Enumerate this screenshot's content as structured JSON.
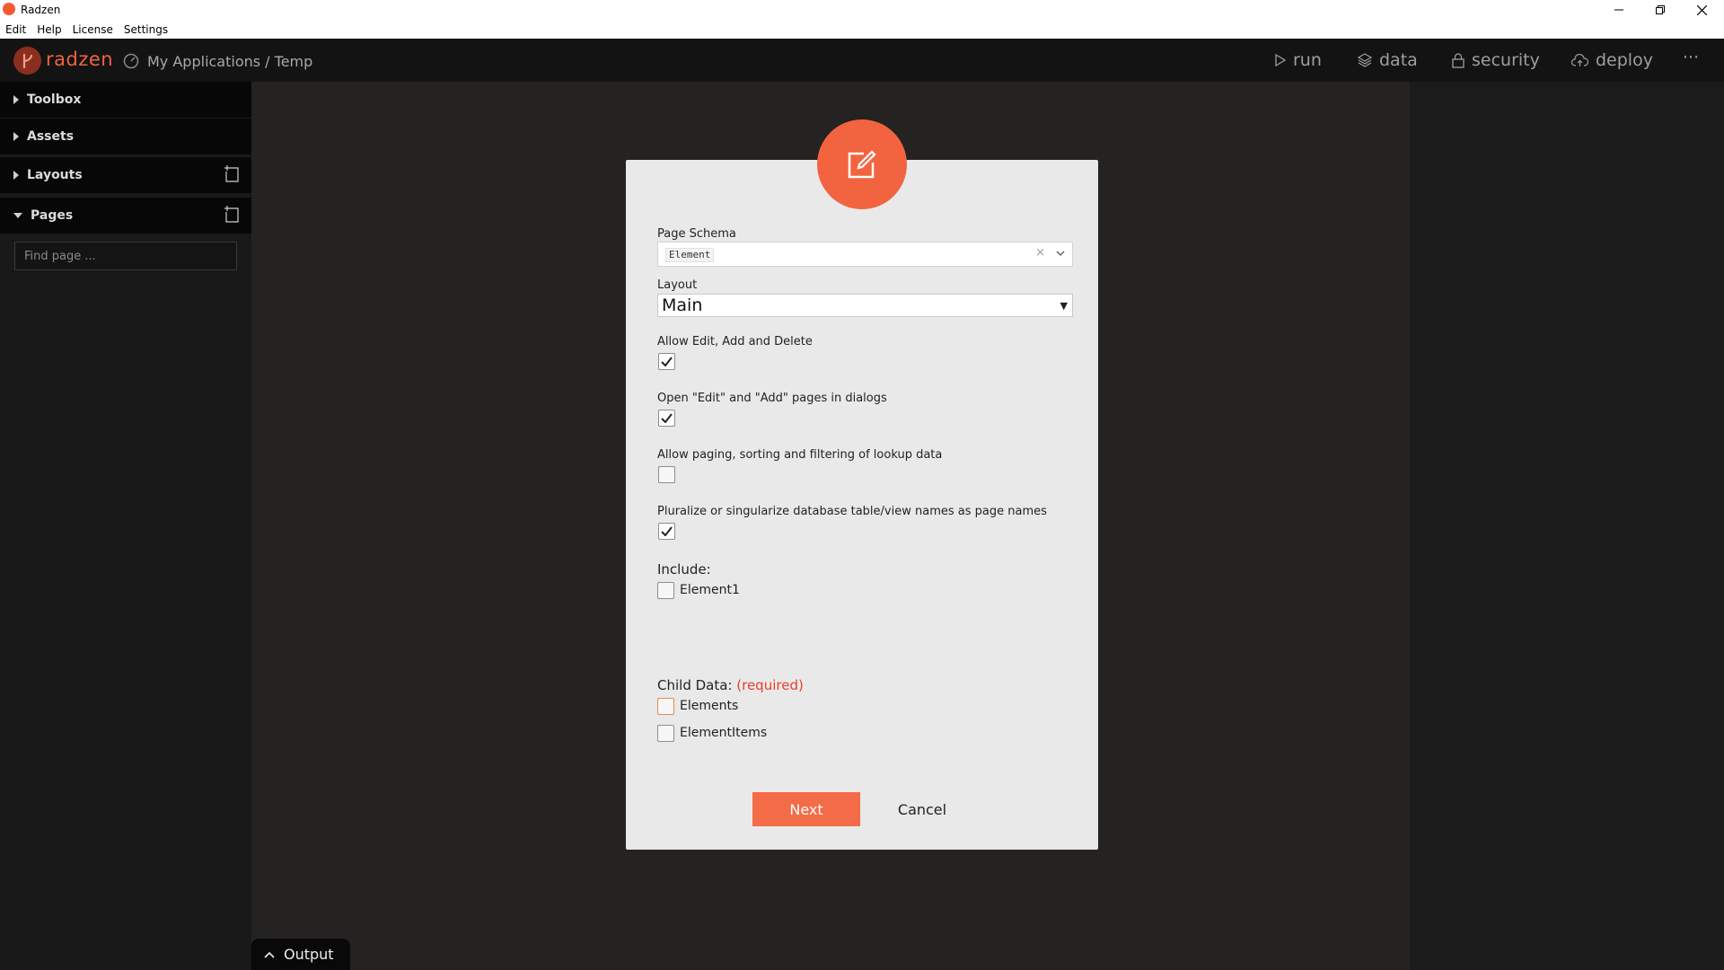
{
  "window": {
    "title": "Radzen"
  },
  "menu": {
    "items": [
      "Edit",
      "Help",
      "License",
      "Settings"
    ]
  },
  "header": {
    "logo": "radzen",
    "breadcrumb": "My Applications / Temp",
    "nav": {
      "run": "run",
      "data": "data",
      "security": "security",
      "deploy": "deploy",
      "more": "···"
    }
  },
  "sidebar": {
    "sections": {
      "toolbox": "Toolbox",
      "assets": "Assets",
      "layouts": "Layouts",
      "pages": "Pages"
    },
    "find_placeholder": "Find page ..."
  },
  "dialog": {
    "page_schema": {
      "label": "Page Schema",
      "value": "Element",
      "clear": "×"
    },
    "layout": {
      "label": "Layout",
      "value": "Main"
    },
    "options": [
      {
        "label": "Allow Edit, Add and Delete",
        "checked": true
      },
      {
        "label": "Open \"Edit\" and \"Add\" pages in dialogs",
        "checked": true
      },
      {
        "label": "Allow paging, sorting and filtering of lookup data",
        "checked": false
      },
      {
        "label": "Pluralize or singularize database table/view names as page names",
        "checked": true
      }
    ],
    "include": {
      "label": "Include:",
      "items": [
        {
          "label": "Element1",
          "checked": false
        }
      ]
    },
    "child_data": {
      "label": "Child Data:",
      "required": "(required)",
      "items": [
        {
          "label": "Elements",
          "checked": false
        },
        {
          "label": "ElementItems",
          "checked": false
        }
      ]
    },
    "buttons": {
      "next": "Next",
      "cancel": "Cancel"
    }
  },
  "output": {
    "label": "Output"
  },
  "colors": {
    "accent": "#f26440",
    "required": "#e8402a"
  }
}
